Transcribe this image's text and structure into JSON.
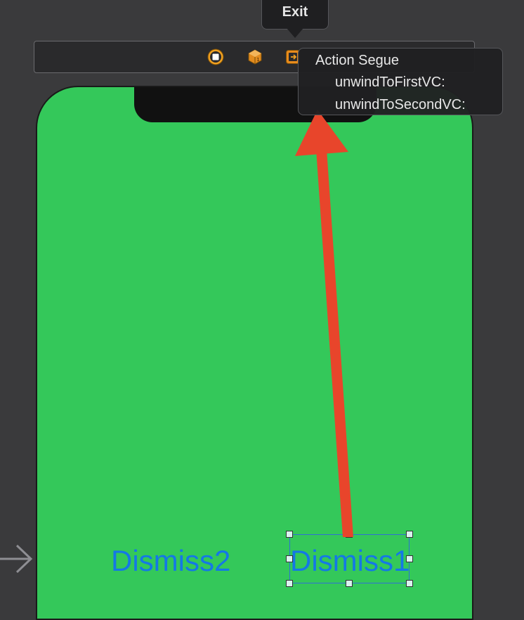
{
  "tooltip": {
    "exit_label": "Exit"
  },
  "dock": {
    "icons": [
      "view-controller-icon",
      "first-responder-icon",
      "exit-icon"
    ]
  },
  "scene": {
    "dismiss2_label": "Dismiss2",
    "dismiss1_label": "Dismiss1"
  },
  "segue_popup": {
    "header": "Action Segue",
    "items": [
      "unwindToFirstVC:",
      "unwindToSecondVC:"
    ]
  },
  "colors": {
    "background": "#3a3a3c",
    "device_green": "#34c85a",
    "button_blue": "#1478e6",
    "drag_arrow": "#e8452b",
    "selection": "#2f6fd6"
  },
  "icons": {
    "entry_point": "arrow-right-icon"
  }
}
